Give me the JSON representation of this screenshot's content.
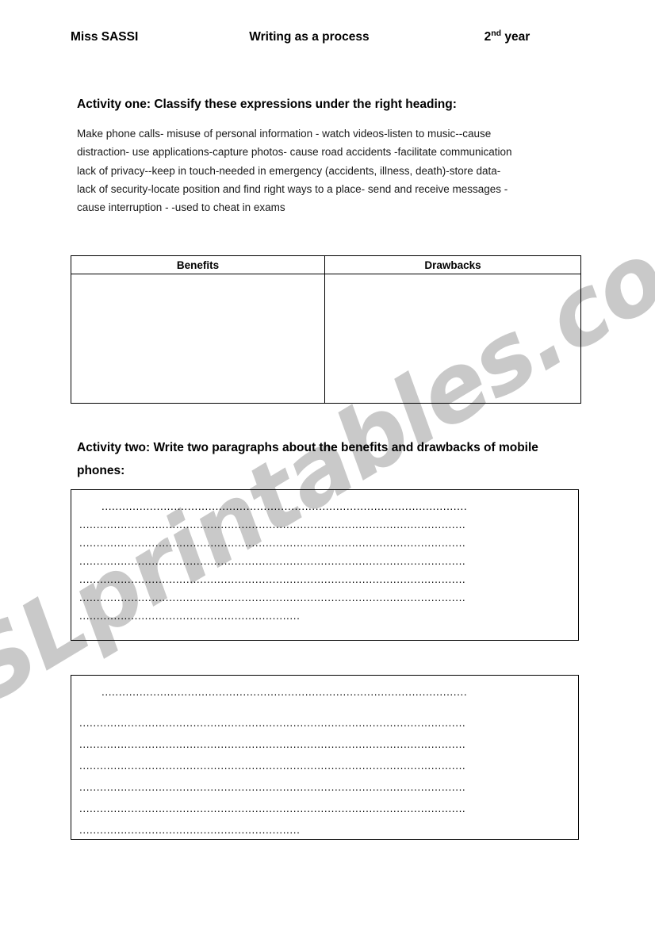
{
  "header": {
    "teacher": "Miss SASSI",
    "title": "Writing as a process",
    "year_number": "2",
    "year_ordinal": "nd",
    "year_word": "year"
  },
  "activity_one": {
    "heading": "Activity one: Classify these expressions under the right heading:",
    "expression_lines": [
      "Make phone calls- misuse of personal information - watch videos-listen to music--cause",
      "distraction- use applications-capture photos- cause road accidents -facilitate communication",
      "lack of privacy--keep in touch-needed in emergency (accidents, illness, death)-store data-",
      "lack of security-locate position and find right ways to a place- send and receive messages -",
      "cause interruption - -used to cheat in exams"
    ],
    "table": {
      "headers": [
        "Benefits",
        "Drawbacks"
      ],
      "rows": [
        [
          "",
          ""
        ]
      ]
    }
  },
  "activity_two": {
    "heading": "Activity two: Write two paragraphs about the benefits and drawbacks of mobile phones:",
    "answer_boxes": [
      {
        "lines": [
          "..........................................................................................................",
          "................................................................................................................",
          "................................................................................................................",
          "................................................................................................................",
          "................................................................................................................",
          "................................................................................................................",
          "................................................................"
        ]
      },
      {
        "lines": [
          "..........................................................................................................",
          "................................................................................................................",
          "................................................................................................................",
          "................................................................................................................",
          "................................................................................................................",
          "................................................................................................................",
          "................................................................"
        ]
      }
    ]
  },
  "watermark": {
    "text": "ESLprintables.com",
    "color": "#c9c9c9"
  }
}
